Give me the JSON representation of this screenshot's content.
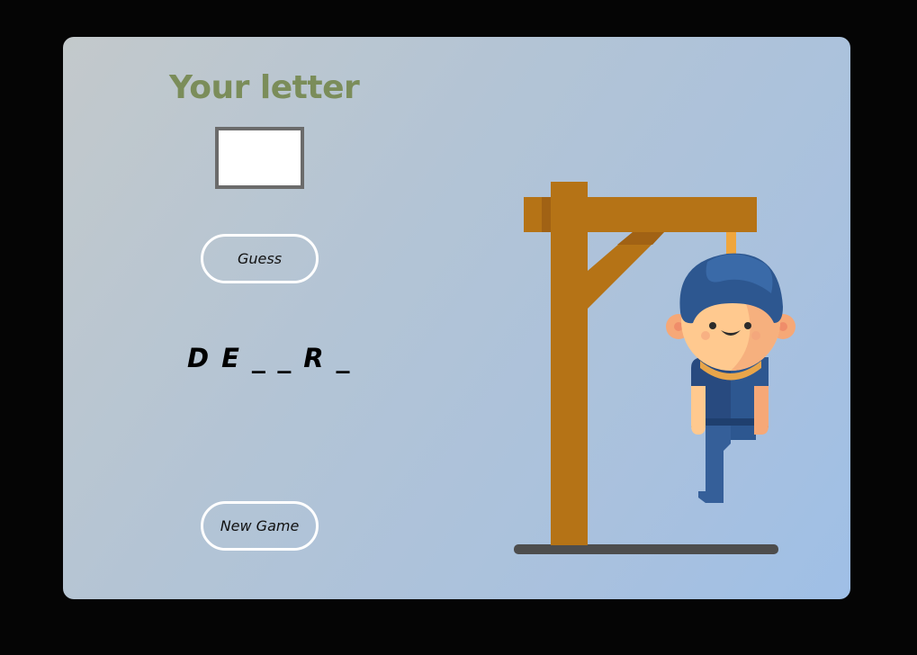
{
  "title": "Your letter",
  "input": {
    "value": "",
    "placeholder": ""
  },
  "buttons": {
    "guess": "Guess",
    "new_game": "New Game"
  },
  "word_display": "D E _ _ R _",
  "colors": {
    "title": "#7b8d5a",
    "gallows_wood": "#b57316",
    "ground": "#4d4d4d",
    "rope": "#f0a63c",
    "hair": "#2d5790",
    "skin": "#ffc98f",
    "shirt": "#284a7f",
    "pants": "#355f99"
  },
  "icons": {
    "figure": "hangman-figure-icon"
  }
}
